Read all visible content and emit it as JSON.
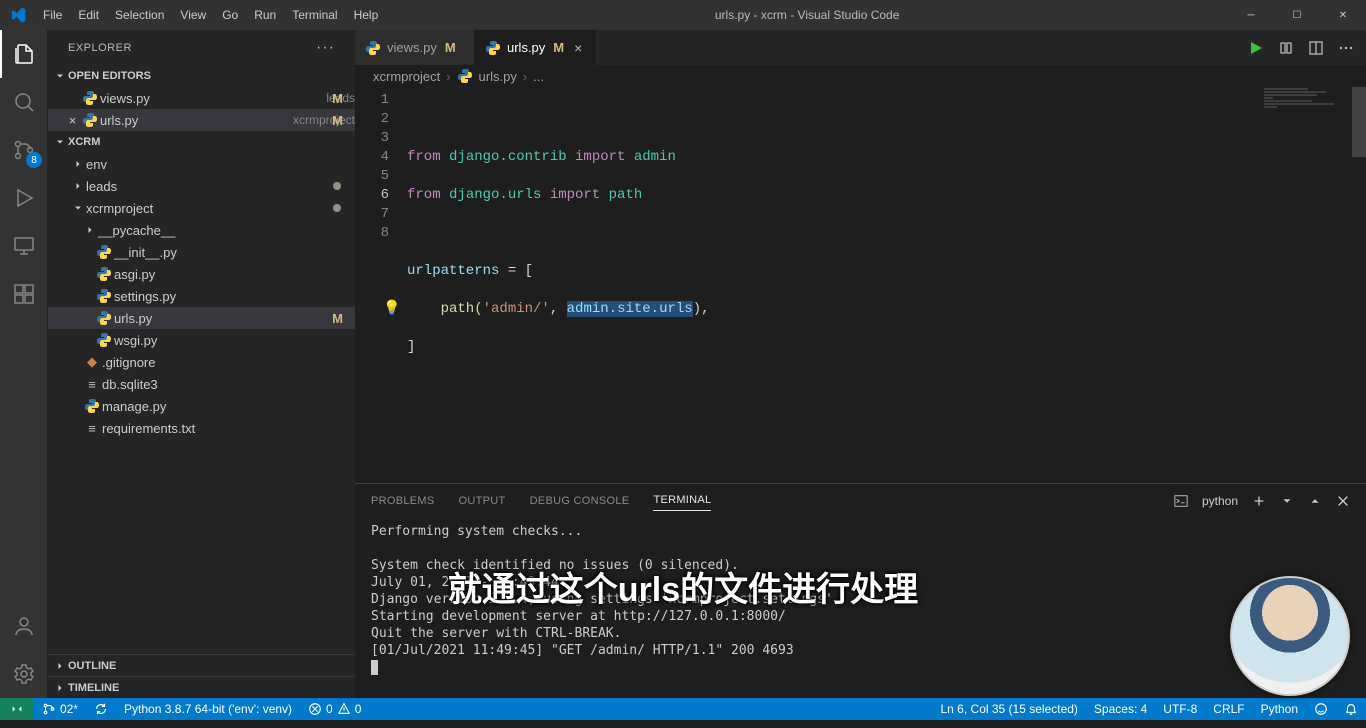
{
  "window": {
    "title": "urls.py - xcrm - Visual Studio Code"
  },
  "menu": {
    "file": "File",
    "edit": "Edit",
    "selection": "Selection",
    "view": "View",
    "go": "Go",
    "run": "Run",
    "terminal": "Terminal",
    "help": "Help"
  },
  "activity": {
    "scm_badge": "8"
  },
  "sidebar": {
    "title": "EXPLORER",
    "open_editors": "OPEN EDITORS",
    "editors": [
      {
        "name": "views.py",
        "desc": "leads",
        "badge": "M"
      },
      {
        "name": "urls.py",
        "desc": "xcrmproject",
        "badge": "M"
      }
    ],
    "workspace": "XCRM",
    "tree": {
      "env": "env",
      "leads": "leads",
      "xcrmproject": "xcrmproject",
      "pycache": "__pycache__",
      "init": "__init__.py",
      "asgi": "asgi.py",
      "settings": "settings.py",
      "urls": "urls.py",
      "urls_badge": "M",
      "wsgi": "wsgi.py",
      "gitignore": ".gitignore",
      "db": "db.sqlite3",
      "manage": "manage.py",
      "requirements": "requirements.txt"
    },
    "outline": "OUTLINE",
    "timeline": "TIMELINE"
  },
  "tabs": {
    "views": {
      "label": "views.py",
      "badge": "M"
    },
    "urls": {
      "label": "urls.py",
      "badge": "M"
    }
  },
  "breadcrumbs": {
    "p0": "xcrmproject",
    "p1": "urls.py",
    "p2": "..."
  },
  "code": {
    "l2_from": "from",
    "l2_mod": " django.contrib ",
    "l2_import": "import",
    "l2_admin": " admin",
    "l3_from": "from",
    "l3_mod": " django.urls ",
    "l3_import": "import",
    "l3_path": " path",
    "l5_var": "urlpatterns",
    "l5_eq": " = [",
    "l6_pre": "    path(",
    "l6_str": "'admin/'",
    "l6_mid": ", ",
    "l6_sel": "admin.site.urls",
    "l6_end": "),",
    "l7": "]",
    "bulb": "💡"
  },
  "panel": {
    "tabs": {
      "problems": "PROBLEMS",
      "output": "OUTPUT",
      "debug": "DEBUG CONSOLE",
      "terminal": "TERMINAL"
    },
    "shell": "python",
    "terminal_lines": "Performing system checks...\n\nSystem check identified no issues (0 silenced).\nJuly 01, 2021 - 11:49:44\nDjango version 3.2.4, using settings 'xcrmproject.settings'\nStarting development server at http://127.0.0.1:8000/\nQuit the server with CTRL-BREAK.\n[01/Jul/2021 11:49:45] \"GET /admin/ HTTP/1.1\" 200 4693"
  },
  "statusbar": {
    "branch": "02*",
    "sync": "",
    "python": "Python 3.8.7 64-bit ('env': venv)",
    "errors": "0",
    "warnings": "0",
    "selection": "Ln 6, Col 35 (15 selected)",
    "spaces": "Spaces: 4",
    "encoding": "UTF-8",
    "eol": "CRLF",
    "lang": "Python",
    "feedback": ""
  },
  "caption": "就通过这个urls的文件进行处理"
}
